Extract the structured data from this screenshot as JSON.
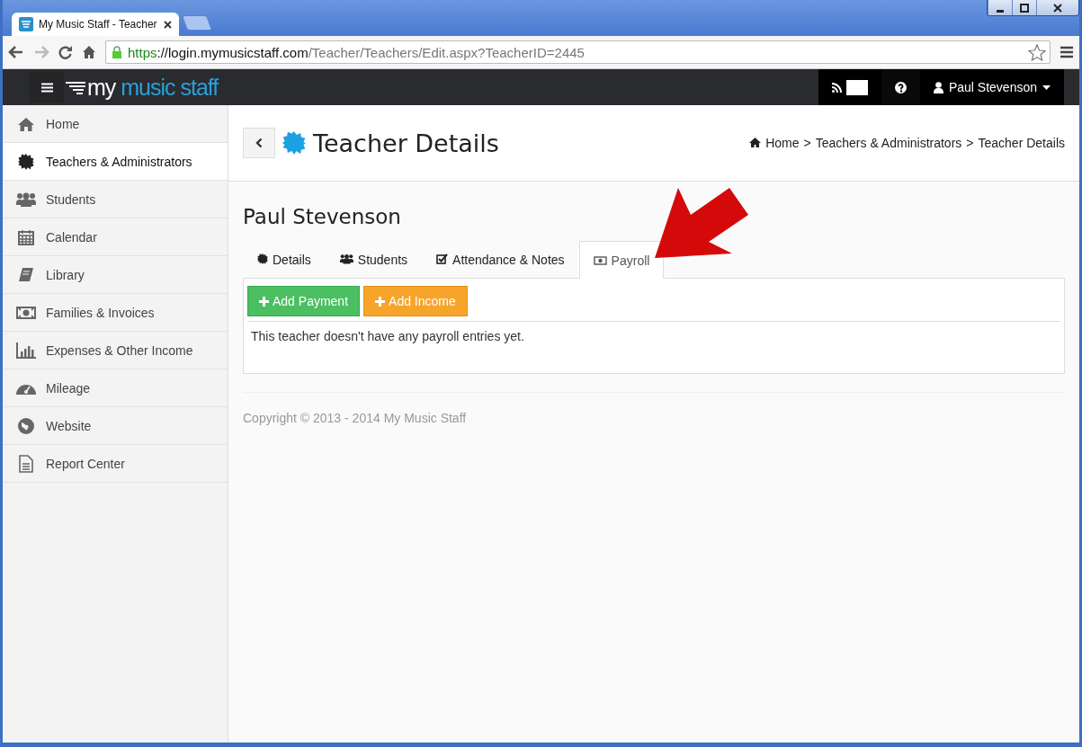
{
  "browser": {
    "tab_title": "My Music Staff - Teacher",
    "url_scheme": "https",
    "url_host": "://login.mymusicstaff.com",
    "url_path": "/Teacher/Teachers/Edit.aspx?TeacherID=2445"
  },
  "navbar": {
    "logo_my": "my",
    "logo_rest": " music staff",
    "user": "Paul Stevenson"
  },
  "sidebar": {
    "items": [
      {
        "label": "Home",
        "selected": false
      },
      {
        "label": "Teachers & Administrators",
        "selected": true
      },
      {
        "label": "Students",
        "selected": false
      },
      {
        "label": "Calendar",
        "selected": false
      },
      {
        "label": "Library",
        "selected": false
      },
      {
        "label": "Families & Invoices",
        "selected": false
      },
      {
        "label": "Expenses & Other Income",
        "selected": false
      },
      {
        "label": "Mileage",
        "selected": false
      },
      {
        "label": "Website",
        "selected": false
      },
      {
        "label": "Report Center",
        "selected": false
      }
    ]
  },
  "header": {
    "title": "Teacher Details",
    "breadcrumb": [
      "Home",
      "Teachers & Administrators",
      "Teacher Details"
    ],
    "separator": ">"
  },
  "teacher_name": "Paul Stevenson",
  "tabs": [
    {
      "label": "Details",
      "selected": false
    },
    {
      "label": "Students",
      "selected": false
    },
    {
      "label": "Attendance & Notes",
      "selected": false
    },
    {
      "label": "Payroll",
      "selected": true
    }
  ],
  "buttons": [
    {
      "label": "Add Payment",
      "kind": "success"
    },
    {
      "label": "Add Income",
      "kind": "warning"
    }
  ],
  "empty_message": "This teacher doesn't have any payroll entries yet.",
  "footer": "Copyright © 2013 - 2014 My Music Staff"
}
